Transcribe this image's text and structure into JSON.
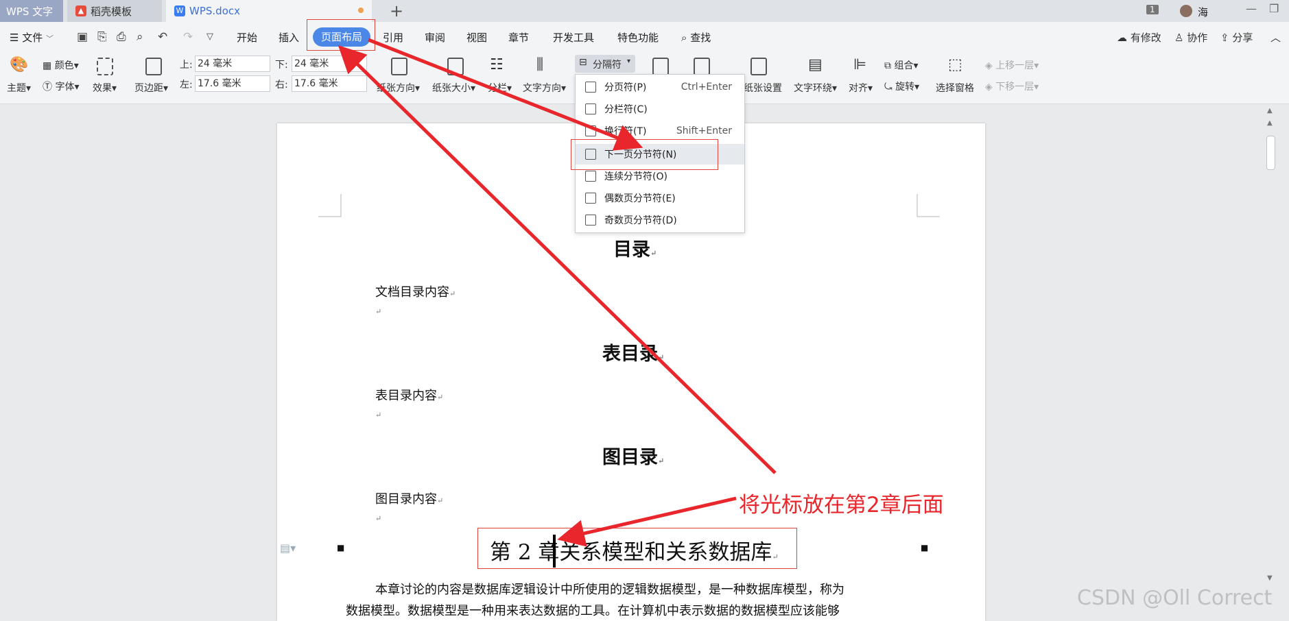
{
  "tabs": {
    "app": "WPS 文字",
    "docer": "稻壳模板",
    "doc": "WPS.docx",
    "new": "+"
  },
  "titlebar": {
    "badge": "1",
    "user": "海"
  },
  "menubar": {
    "file": "文件",
    "items": [
      "开始",
      "插入",
      "页面布局",
      "引用",
      "审阅",
      "视图",
      "章节",
      "开发工具",
      "特色功能",
      "查找"
    ],
    "right": [
      "有修改",
      "协作",
      "分享"
    ]
  },
  "ribbon": {
    "theme": "主题",
    "color": "颜色",
    "font": "字体",
    "effect": "效果",
    "margins": "页边距",
    "top_label": "上:",
    "top_value": "24 毫米",
    "bottom_label": "下:",
    "bottom_value": "24 毫米",
    "left_label": "左:",
    "left_value": "17.6 毫米",
    "right_label": "右:",
    "right_value": "17.6 毫米",
    "orientation": "纸张方向",
    "size": "纸张大小",
    "columns": "分栏",
    "text_direction": "文字方向",
    "separator": "分隔符",
    "paper_setup": "纸张设置",
    "wrap": "文字环绕",
    "align": "对齐",
    "group": "组合",
    "rotate": "旋转",
    "selection_pane": "选择窗格",
    "bring_forward": "上移一层",
    "send_backward": "下移一层"
  },
  "dropdown": {
    "items": [
      {
        "label": "分页符(P)",
        "shortcut": "Ctrl+Enter"
      },
      {
        "label": "分栏符(C)",
        "shortcut": ""
      },
      {
        "label": "换行符(T)",
        "shortcut": "Shift+Enter"
      },
      {
        "label": "下一页分节符(N)",
        "shortcut": ""
      },
      {
        "label": "连续分节符(O)",
        "shortcut": ""
      },
      {
        "label": "偶数页分节符(E)",
        "shortcut": ""
      },
      {
        "label": "奇数页分节符(D)",
        "shortcut": ""
      }
    ]
  },
  "document": {
    "toc_title": "目录",
    "toc_content": "文档目录内容",
    "table_title": "表目录",
    "table_content": "表目录内容",
    "figure_title": "图目录",
    "figure_content": "图目录内容",
    "chapter": "第 2 章关系模型和关系数据库",
    "para_line1": "本章讨论的内容是数据库逻辑设计中所使用的逻辑数据模型，是一种数据库模型，称为",
    "para_line2": "数据模型。数据模型是一种用来表达数据的工具。在计算机中表示数据的数据模型应该能够"
  },
  "annotation": "将光标放在第2章后面",
  "watermark": "CSDN @Oll Correct",
  "colors": {
    "accent": "#4a87e6",
    "annotation_red": "#e8262b"
  }
}
